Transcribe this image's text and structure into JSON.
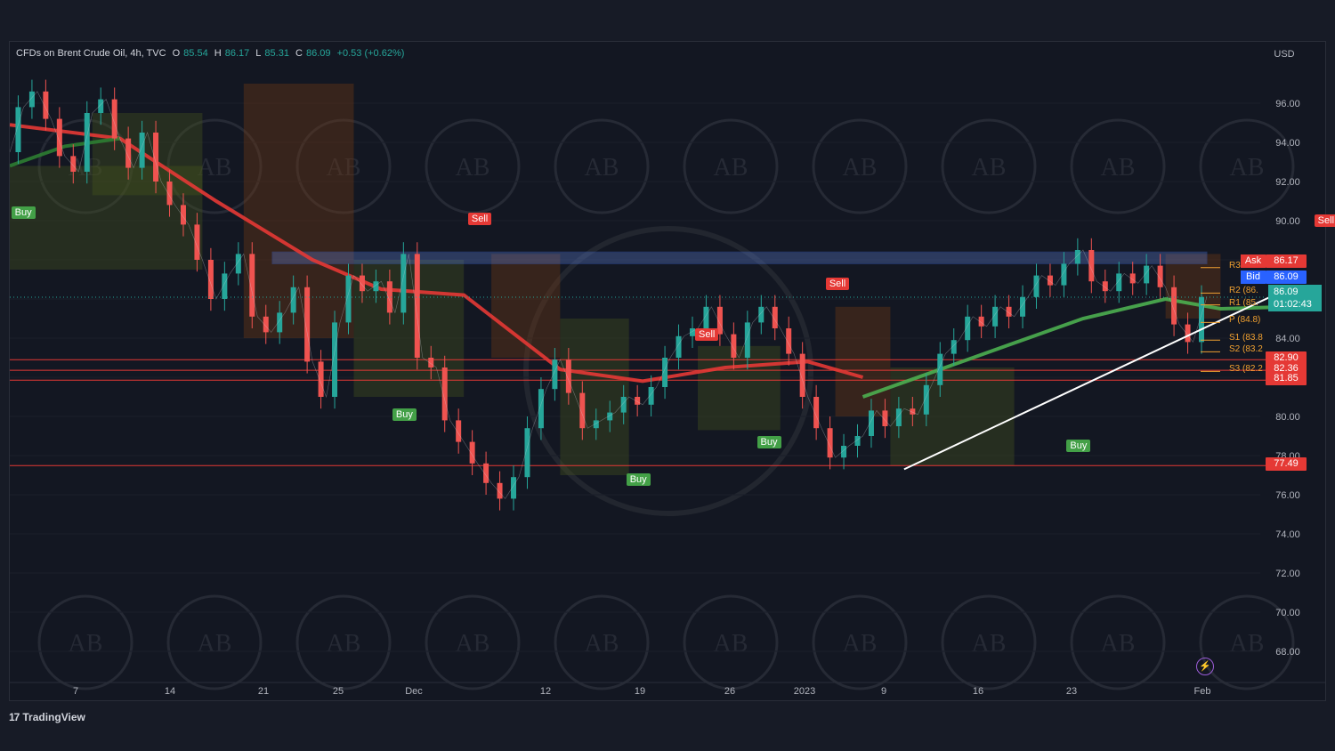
{
  "legend": {
    "title": "CFDs on Brent Crude Oil, 4h, TVC",
    "o_label": "O",
    "o_value": "85.54",
    "h_label": "H",
    "h_value": "86.17",
    "l_label": "L",
    "l_value": "85.31",
    "c_label": "C",
    "c_value": "86.09",
    "change": "+0.53 (+0.62%)"
  },
  "brand": {
    "logo": "17",
    "name": "TradingView"
  },
  "watermark_text": "AB",
  "chart_data": {
    "type": "line",
    "symbol": "CFDs on Brent Crude Oil",
    "timeframe": "4h",
    "currency_label": "USD",
    "ylim": [
      66.5,
      98.5
    ],
    "y_ticks": [
      "96.00",
      "94.00",
      "92.00",
      "90.00",
      "88.00",
      "86.00",
      "84.00",
      "82.00",
      "80.00",
      "78.00",
      "76.00",
      "74.00",
      "72.00",
      "70.00",
      "68.00"
    ],
    "x_ticks": [
      "7",
      "14",
      "21",
      "25",
      "Dec",
      "12",
      "19",
      "26",
      "2023",
      "9",
      "16",
      "23",
      "Feb"
    ],
    "price_path": [
      {
        "t": "Nov 3",
        "p": 93.5
      },
      {
        "t": "Nov 5",
        "p": 95.8
      },
      {
        "t": "Nov 7",
        "p": 96.6
      },
      {
        "t": "Nov 8",
        "p": 95.2
      },
      {
        "t": "Nov 9",
        "p": 93.3
      },
      {
        "t": "Nov 10",
        "p": 92.5
      },
      {
        "t": "Nov 11",
        "p": 95.5
      },
      {
        "t": "Nov 13",
        "p": 96.2
      },
      {
        "t": "Nov 14",
        "p": 94.2
      },
      {
        "t": "Nov 15",
        "p": 92.7
      },
      {
        "t": "Nov 16",
        "p": 94.5
      },
      {
        "t": "Nov 17",
        "p": 92.0
      },
      {
        "t": "Nov 18",
        "p": 90.8
      },
      {
        "t": "Nov 19",
        "p": 89.8
      },
      {
        "t": "Nov 20",
        "p": 88.0
      },
      {
        "t": "Nov 21",
        "p": 86.0
      },
      {
        "t": "Nov 22",
        "p": 87.3
      },
      {
        "t": "Nov 23",
        "p": 88.3
      },
      {
        "t": "Nov 24",
        "p": 85.1
      },
      {
        "t": "Nov 25",
        "p": 84.3
      },
      {
        "t": "Nov 26",
        "p": 85.3
      },
      {
        "t": "Nov 27",
        "p": 86.6
      },
      {
        "t": "Nov 28",
        "p": 82.8
      },
      {
        "t": "Nov 29",
        "p": 81.0
      },
      {
        "t": "Nov 30",
        "p": 84.8
      },
      {
        "t": "Dec 1",
        "p": 87.2
      },
      {
        "t": "Dec 2",
        "p": 86.4
      },
      {
        "t": "Dec 3",
        "p": 86.9
      },
      {
        "t": "Dec 4",
        "p": 85.3
      },
      {
        "t": "Dec 5",
        "p": 88.3
      },
      {
        "t": "Dec 6",
        "p": 83.0
      },
      {
        "t": "Dec 7",
        "p": 82.5
      },
      {
        "t": "Dec 8",
        "p": 79.8
      },
      {
        "t": "Dec 9",
        "p": 78.7
      },
      {
        "t": "Dec 10",
        "p": 77.6
      },
      {
        "t": "Dec 11",
        "p": 76.6
      },
      {
        "t": "Dec 12",
        "p": 75.8
      },
      {
        "t": "Dec 13",
        "p": 76.9
      },
      {
        "t": "Dec 14",
        "p": 79.4
      },
      {
        "t": "Dec 15",
        "p": 81.4
      },
      {
        "t": "Dec 16",
        "p": 82.9
      },
      {
        "t": "Dec 17",
        "p": 81.2
      },
      {
        "t": "Dec 18",
        "p": 79.4
      },
      {
        "t": "Dec 19",
        "p": 79.8
      },
      {
        "t": "Dec 20",
        "p": 80.2
      },
      {
        "t": "Dec 21",
        "p": 81.0
      },
      {
        "t": "Dec 22",
        "p": 80.6
      },
      {
        "t": "Dec 23",
        "p": 81.5
      },
      {
        "t": "Dec 24",
        "p": 83.0
      },
      {
        "t": "Dec 25",
        "p": 84.1
      },
      {
        "t": "Dec 26",
        "p": 84.5
      },
      {
        "t": "Dec 27",
        "p": 85.6
      },
      {
        "t": "Dec 28",
        "p": 84.2
      },
      {
        "t": "Dec 29",
        "p": 83.0
      },
      {
        "t": "Dec 30",
        "p": 84.8
      },
      {
        "t": "Dec 31",
        "p": 85.6
      },
      {
        "t": "Jan 1",
        "p": 84.5
      },
      {
        "t": "Jan 2",
        "p": 83.2
      },
      {
        "t": "Jan 3",
        "p": 81.0
      },
      {
        "t": "Jan 4",
        "p": 79.4
      },
      {
        "t": "Jan 5",
        "p": 77.9
      },
      {
        "t": "Jan 6",
        "p": 78.5
      },
      {
        "t": "Jan 7",
        "p": 79.0
      },
      {
        "t": "Jan 8",
        "p": 80.3
      },
      {
        "t": "Jan 9",
        "p": 79.5
      },
      {
        "t": "Jan 10",
        "p": 80.4
      },
      {
        "t": "Jan 11",
        "p": 80.1
      },
      {
        "t": "Jan 12",
        "p": 81.6
      },
      {
        "t": "Jan 13",
        "p": 83.2
      },
      {
        "t": "Jan 14",
        "p": 83.9
      },
      {
        "t": "Jan 15",
        "p": 85.1
      },
      {
        "t": "Jan 16",
        "p": 84.6
      },
      {
        "t": "Jan 17",
        "p": 85.6
      },
      {
        "t": "Jan 18",
        "p": 85.1
      },
      {
        "t": "Jan 19",
        "p": 86.1
      },
      {
        "t": "Jan 20",
        "p": 87.2
      },
      {
        "t": "Jan 21",
        "p": 86.7
      },
      {
        "t": "Jan 22",
        "p": 87.8
      },
      {
        "t": "Jan 23",
        "p": 88.5
      },
      {
        "t": "Jan 24",
        "p": 86.9
      },
      {
        "t": "Jan 25",
        "p": 86.4
      },
      {
        "t": "Jan 26",
        "p": 87.3
      },
      {
        "t": "Jan 27",
        "p": 86.8
      },
      {
        "t": "Jan 28",
        "p": 87.7
      },
      {
        "t": "Jan 29",
        "p": 86.6
      },
      {
        "t": "Jan 30",
        "p": 84.7
      },
      {
        "t": "Jan 31",
        "p": 83.8
      },
      {
        "t": "Feb 1",
        "p": 86.1
      }
    ],
    "moving_averages": [
      {
        "name": "ma-red-1",
        "color": "#e53935",
        "points": [
          [
            0,
            94.9
          ],
          [
            8,
            94.2
          ],
          [
            15,
            91.0
          ],
          [
            22,
            88.0
          ],
          [
            27,
            86.5
          ],
          [
            33,
            86.2
          ],
          [
            40,
            82.4
          ],
          [
            46,
            81.8
          ],
          [
            52,
            82.5
          ],
          [
            58,
            82.8
          ],
          [
            62,
            82.0
          ]
        ]
      },
      {
        "name": "ma-green-1",
        "color": "#4caf50",
        "points": [
          [
            62,
            81.0
          ],
          [
            70,
            83.0
          ],
          [
            78,
            85.0
          ],
          [
            84,
            86.0
          ],
          [
            88,
            85.5
          ],
          [
            93,
            85.6
          ]
        ]
      },
      {
        "name": "ma-green-2",
        "color": "#2e7d32",
        "points": [
          [
            0,
            92.8
          ],
          [
            4,
            93.8
          ],
          [
            8,
            94.2
          ]
        ]
      }
    ],
    "horizontal_levels": [
      {
        "label": "82.90",
        "value": 82.9,
        "color": "#e53935"
      },
      {
        "label": "82.36",
        "value": 82.36,
        "color": "#e53935"
      },
      {
        "label": "81.85",
        "value": 81.85,
        "color": "#e53935"
      },
      {
        "label": "77.49",
        "value": 77.49,
        "color": "#e53935"
      }
    ],
    "pivots": [
      {
        "label": "R3",
        "value": 87.6
      },
      {
        "label": "R2 (86.",
        "value": 86.3
      },
      {
        "label": "R1 (85.",
        "value": 85.7
      },
      {
        "label": "P (84.8)",
        "value": 84.8
      },
      {
        "label": "S1 (83.8",
        "value": 83.9
      },
      {
        "label": "S2 (83.2",
        "value": 83.3
      },
      {
        "label": "S3 (82.2",
        "value": 82.3
      }
    ],
    "resistance_zone": [
      87.8,
      88.4
    ],
    "signals": [
      {
        "label": "Buy",
        "type": "buy",
        "t": 0.3,
        "value": 90.3
      },
      {
        "label": "Sell",
        "type": "sell",
        "t": 33.5,
        "value": 90.0
      },
      {
        "label": "Buy",
        "type": "buy",
        "t": 28,
        "value": 80.0
      },
      {
        "label": "Sell",
        "type": "sell",
        "t": 50,
        "value": 84.1
      },
      {
        "label": "Buy",
        "type": "buy",
        "t": 45,
        "value": 76.7
      },
      {
        "label": "Buy",
        "type": "buy",
        "t": 54.5,
        "value": 78.6
      },
      {
        "label": "Sell",
        "type": "sell",
        "t": 59.5,
        "value": 86.7
      },
      {
        "label": "Buy",
        "type": "buy",
        "t": 77,
        "value": 78.4
      },
      {
        "label": "Sell",
        "type": "sell",
        "t": 95,
        "value": 89.9
      }
    ],
    "trendline": {
      "from": [
        65,
        77.3
      ],
      "to": [
        92.5,
        86.4
      ]
    },
    "price_tags": {
      "ask_label": "Ask",
      "ask": "86.17",
      "bid_label": "Bid",
      "bid": "86.09",
      "last": "86.09",
      "countdown": "01:02:43"
    },
    "colors": {
      "up": "#26a69a",
      "down": "#ef5350",
      "red_ma": "#e53935",
      "green_ma": "#4caf50",
      "bid": "#2962ff",
      "last": "#26a69a"
    }
  }
}
